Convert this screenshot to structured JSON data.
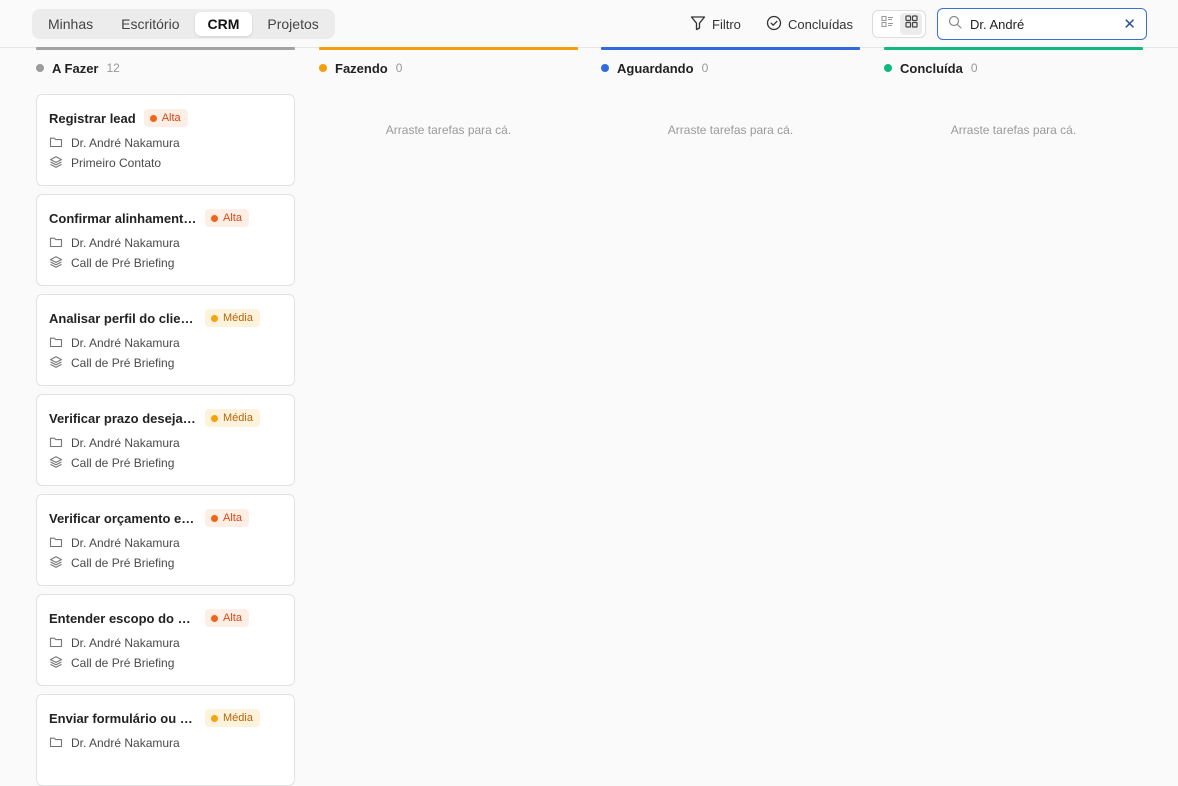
{
  "tabs": [
    {
      "label": "Minhas",
      "active": false
    },
    {
      "label": "Escritório",
      "active": false
    },
    {
      "label": "CRM",
      "active": true
    },
    {
      "label": "Projetos",
      "active": false
    }
  ],
  "toolbar": {
    "filter_label": "Filtro",
    "completed_label": "Concluídas",
    "view_list_icon": "list-view-icon",
    "view_grid_icon": "grid-view-icon"
  },
  "search": {
    "value": "Dr. André",
    "clear_glyph": "✕"
  },
  "columns": [
    {
      "name": "A Fazer",
      "count": "12",
      "color": "#9b9b9b",
      "empty_text": ""
    },
    {
      "name": "Fazendo",
      "count": "0",
      "color": "#f59e0b",
      "empty_text": "Arraste tarefas para cá."
    },
    {
      "name": "Aguardando",
      "count": "0",
      "color": "#2f6bdc",
      "empty_text": "Arraste tarefas para cá."
    },
    {
      "name": "Concluída",
      "count": "0",
      "color": "#10b981",
      "empty_text": "Arraste tarefas para cá."
    }
  ],
  "cards": [
    {
      "title": "Registrar lead",
      "priority": "Alta",
      "priority_level": "alta",
      "client": "Dr. André Nakamura",
      "stage": "Primeiro Contato"
    },
    {
      "title": "Confirmar alinhamento da call",
      "priority": "Alta",
      "priority_level": "alta",
      "client": "Dr. André Nakamura",
      "stage": "Call de Pré Briefing"
    },
    {
      "title": "Analisar perfil do cliente",
      "priority": "Média",
      "priority_level": "media",
      "client": "Dr. André Nakamura",
      "stage": "Call de Pré Briefing"
    },
    {
      "title": "Verificar prazo desejado",
      "priority": "Média",
      "priority_level": "media",
      "client": "Dr. André Nakamura",
      "stage": "Call de Pré Briefing"
    },
    {
      "title": "Verificar orçamento estimado",
      "priority": "Alta",
      "priority_level": "alta",
      "client": "Dr. André Nakamura",
      "stage": "Call de Pré Briefing"
    },
    {
      "title": "Entender escopo do projeto",
      "priority": "Alta",
      "priority_level": "alta",
      "client": "Dr. André Nakamura",
      "stage": "Call de Pré Briefing"
    },
    {
      "title": "Enviar formulário ou briefing",
      "priority": "Média",
      "priority_level": "media",
      "client": "Dr. André Nakamura",
      "stage": ""
    }
  ]
}
